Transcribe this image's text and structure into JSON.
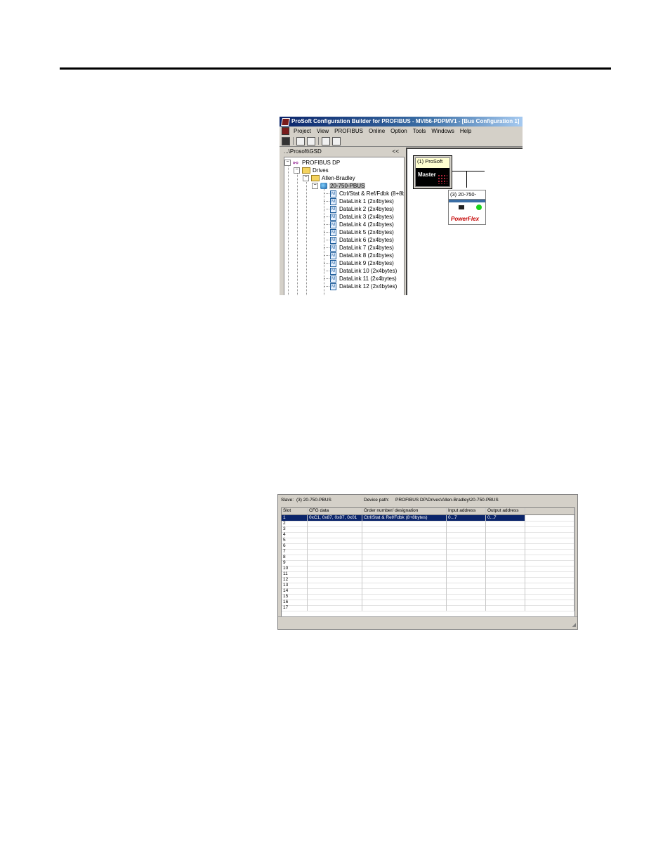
{
  "window": {
    "title": "ProSoft Configuration Builder for PROFIBUS - MVI56-PDPMV1 - [Bus Configuration 1]",
    "menu": [
      "Project",
      "View",
      "PROFIBUS",
      "Online",
      "Option",
      "Tools",
      "Windows",
      "Help"
    ],
    "toolbar_icons": [
      "save-icon",
      "print-icon",
      "print-preview-icon",
      "upload-icon",
      "connect-icon"
    ]
  },
  "left_panel": {
    "path": "...\\Prosoft\\GSD",
    "collapse": "<<",
    "tree": {
      "root": "PROFIBUS DP",
      "drives": "Drives",
      "vendor": "Allen-Bradley",
      "device": "20-750-PBUS",
      "modules": [
        "Ctrl/Stat & Ref/Fdbk (8+8b",
        "DataLink 1 (2x4bytes)",
        "DataLink 2 (2x4bytes)",
        "DataLink 3 (2x4bytes)",
        "DataLink 4 (2x4bytes)",
        "DataLink 5 (2x4bytes)",
        "DataLink 6 (2x4bytes)",
        "DataLink 7 (2x4bytes)",
        "DataLink 8 (2x4bytes)",
        "DataLink 9 (2x4bytes)",
        "DataLink 10 (2x4bytes)",
        "DataLink 11 (2x4bytes)",
        "DataLink 12 (2x4bytes)"
      ]
    }
  },
  "bus_view": {
    "master_title": "(1) ProSoft",
    "master_label": "Master",
    "slave_title": "(3) 20-750-",
    "slave_logo": "PowerFlex",
    "led_color": "#19d419"
  },
  "slave_config": {
    "slave_label": "Slave:",
    "slave_value": "(3) 20-750-PBUS",
    "path_label": "Device path:",
    "path_value": "PROFIBUS DP\\Drives\\Allen-Bradley\\20-750-PBUS",
    "columns": [
      "Slot",
      "CFG data",
      "Order number/ designation",
      "Input address",
      "Output address"
    ],
    "rows": [
      [
        "1",
        "0xC1, 0x87, 0x87, 0x01",
        "Ctrl/Stat & Ref/Fdbk (8+8bytes)",
        "0...7",
        "0...7"
      ],
      [
        "2",
        "",
        "",
        "",
        ""
      ],
      [
        "3",
        "",
        "",
        "",
        ""
      ],
      [
        "4",
        "",
        "",
        "",
        ""
      ],
      [
        "5",
        "",
        "",
        "",
        ""
      ],
      [
        "6",
        "",
        "",
        "",
        ""
      ],
      [
        "7",
        "",
        "",
        "",
        ""
      ],
      [
        "8",
        "",
        "",
        "",
        ""
      ],
      [
        "9",
        "",
        "",
        "",
        ""
      ],
      [
        "10",
        "",
        "",
        "",
        ""
      ],
      [
        "11",
        "",
        "",
        "",
        ""
      ],
      [
        "12",
        "",
        "",
        "",
        ""
      ],
      [
        "13",
        "",
        "",
        "",
        ""
      ],
      [
        "14",
        "",
        "",
        "",
        ""
      ],
      [
        "15",
        "",
        "",
        "",
        ""
      ],
      [
        "16",
        "",
        "",
        "",
        ""
      ],
      [
        "17",
        "",
        "",
        "",
        ""
      ]
    ],
    "selected_color": "#0a246a"
  }
}
